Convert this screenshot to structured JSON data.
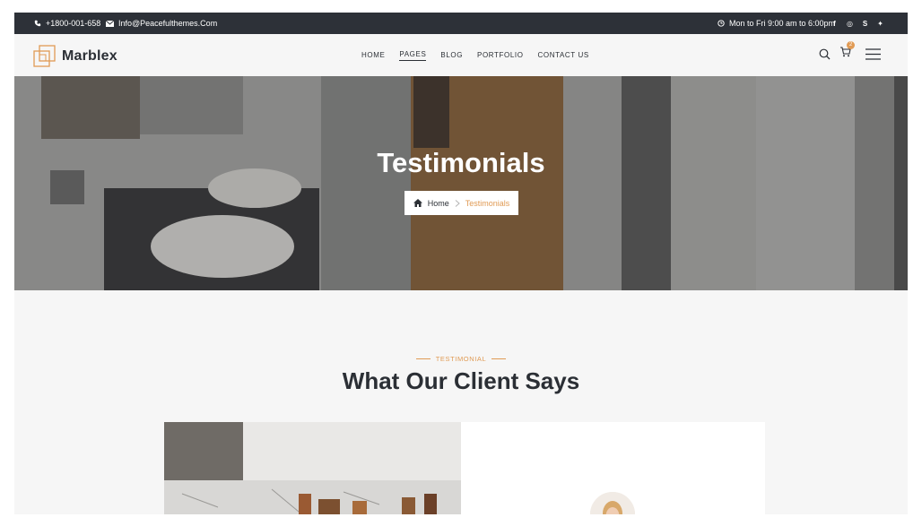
{
  "topbar": {
    "phone": "+1800-001-658",
    "email": "Info@Peacefulthemes.Com",
    "hours": "Mon to Fri 9:00 am to 6:00pm",
    "social": [
      "facebook-icon",
      "instagram-icon",
      "skype-icon",
      "twitter-icon"
    ]
  },
  "header": {
    "logo_text": "Marblex",
    "nav": [
      "HOME",
      "PAGES",
      "BLOG",
      "PORTFOLIO",
      "CONTACT US"
    ],
    "active_nav": "PAGES",
    "cart_count": "2"
  },
  "hero": {
    "title": "Testimonials",
    "breadcrumb_home": "Home",
    "breadcrumb_current": "Testimonials"
  },
  "section": {
    "eyebrow": "TESTIMONIAL",
    "title": "What Our Client Says"
  },
  "colors": {
    "accent": "#e09b55",
    "dark": "#2d3138",
    "background": "#f6f6f6"
  }
}
